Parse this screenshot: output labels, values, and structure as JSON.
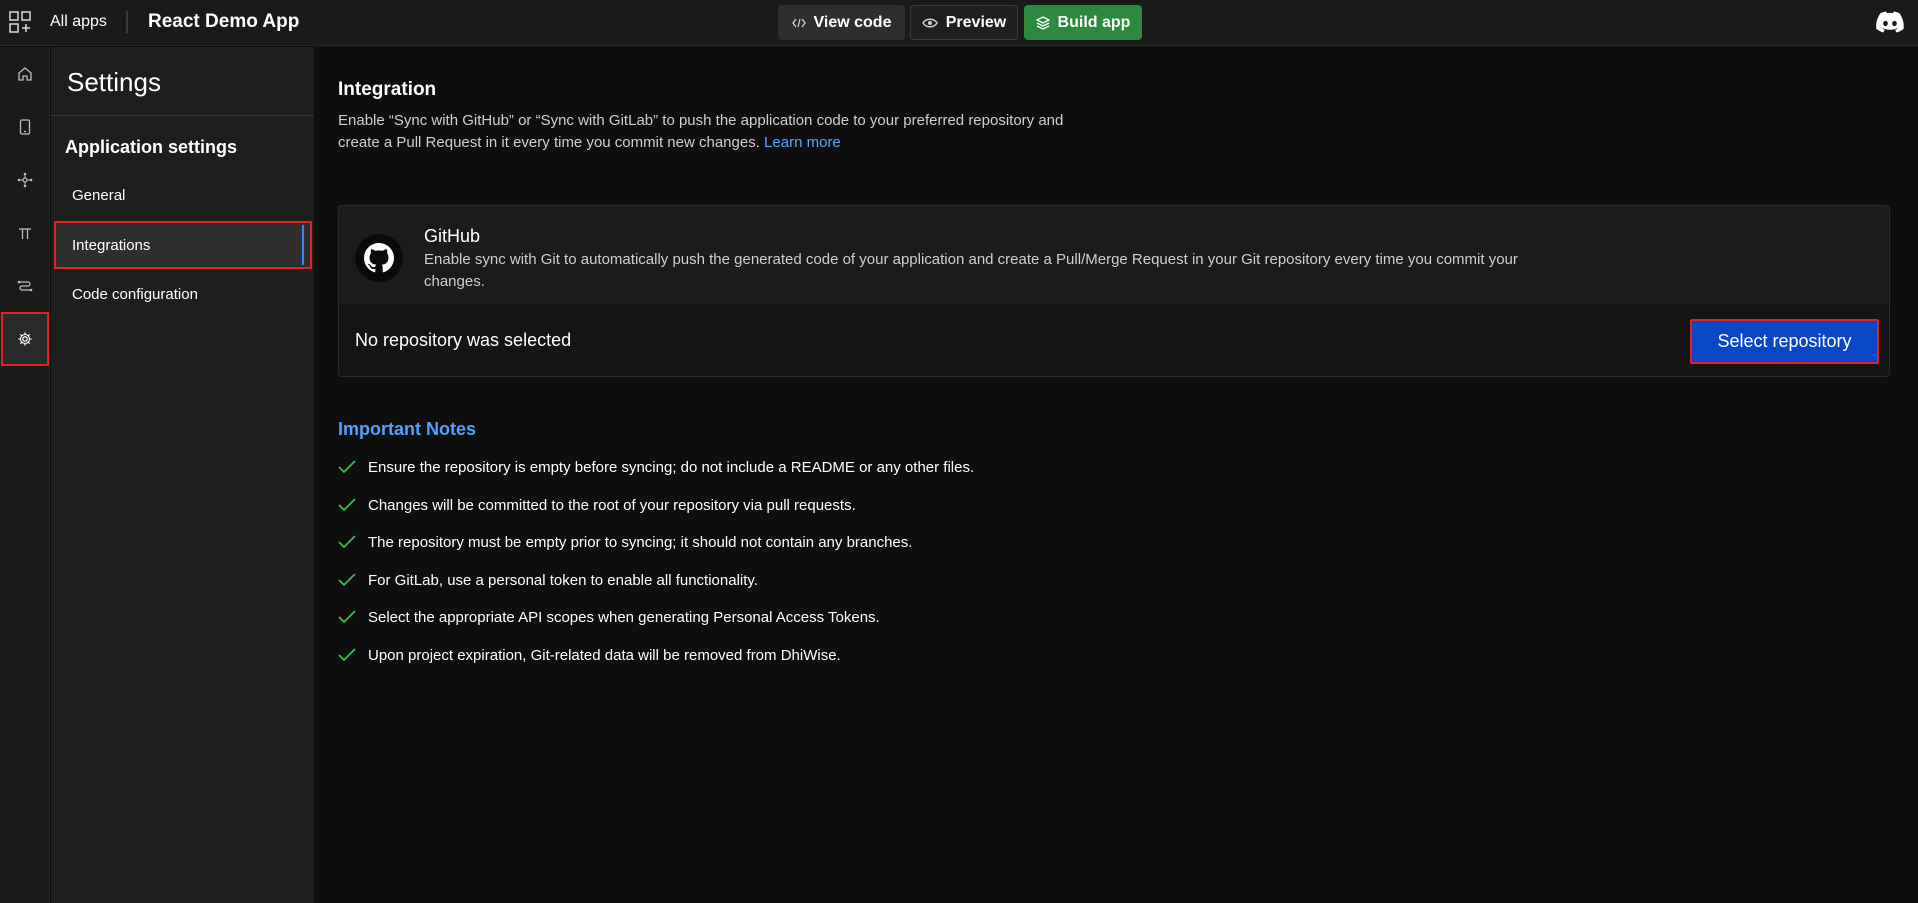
{
  "topbar": {
    "all_apps_label": "All apps",
    "app_title": "React Demo App",
    "view_code_label": "View code",
    "preview_label": "Preview",
    "build_app_label": "Build app",
    "icons": [
      "apps-grid-icon",
      "code-icon",
      "eye-icon",
      "layers-icon",
      "discord-icon"
    ]
  },
  "rail": {
    "items": [
      "home-icon",
      "mobile-icon",
      "nodes-icon",
      "pi-icon",
      "flow-icon",
      "gear-icon"
    ],
    "active": "gear-icon"
  },
  "settings": {
    "title": "Settings",
    "section_title": "Application settings",
    "nav": [
      {
        "label": "General",
        "active": false
      },
      {
        "label": "Integrations",
        "active": true
      },
      {
        "label": "Code configuration",
        "active": false
      }
    ]
  },
  "integration": {
    "title": "Integration",
    "description": "Enable “Sync with GitHub” or “Sync with GitLab” to push the application code to your preferred repository and create a Pull Request in it every time you commit new changes.",
    "learn_more": "Learn more"
  },
  "github_card": {
    "title": "GitHub",
    "description": "Enable sync with Git to automatically push the generated code of your application and create a Pull/Merge Request in your Git repository every time you commit your changes.",
    "status": "No repository was selected",
    "select_button": "Select repository"
  },
  "notes": {
    "title": "Important Notes",
    "items": [
      "Ensure the repository is empty before syncing; do not include a README or any other files.",
      "Changes will be committed to the root of your repository via pull requests.",
      "The repository must be empty prior to syncing; it should not contain any branches.",
      "For GitLab, use a personal token to enable all functionality.",
      "Select the appropriate API scopes when generating Personal Access Tokens.",
      "Upon project expiration, Git-related data will be removed from DhiWise."
    ]
  },
  "colors": {
    "accent_blue": "#0a47c7",
    "link_blue": "#5ea1ff",
    "build_green": "#2b8a3e",
    "check_green": "#3fb950",
    "highlight_red": "#e02424"
  }
}
